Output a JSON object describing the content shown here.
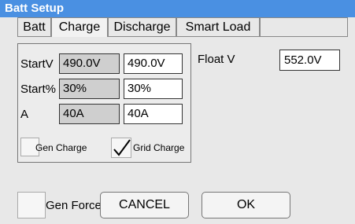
{
  "window": {
    "title": "Batt Setup"
  },
  "tabs": [
    {
      "label": "Batt"
    },
    {
      "label": "Charge"
    },
    {
      "label": "Discharge"
    },
    {
      "label": "Smart Load"
    }
  ],
  "charge": {
    "rows": [
      {
        "label": "StartV",
        "readonly": "490.0V",
        "value": "490.0V"
      },
      {
        "label": "Start%",
        "readonly": "30%",
        "value": "30%"
      },
      {
        "label": "A",
        "readonly": "40A",
        "value": "40A"
      }
    ],
    "gen_charge_label": "Gen Charge",
    "grid_charge_label": "Grid Charge",
    "float_v_label": "Float V",
    "float_v_value": "552.0V"
  },
  "footer": {
    "gen_force_label": "Gen Force",
    "cancel_label": "CANCEL",
    "ok_label": "OK"
  },
  "colors": {
    "titlebar": "#4a90e2"
  }
}
